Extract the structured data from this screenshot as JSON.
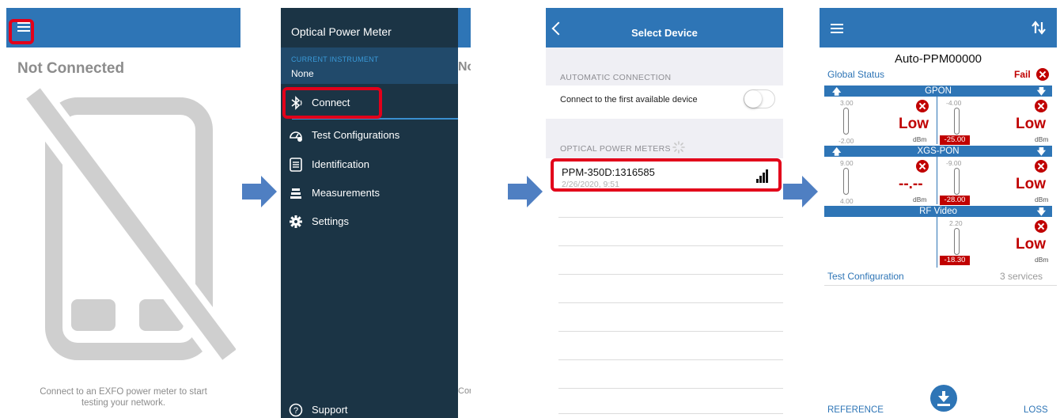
{
  "colors": {
    "accent": "#2e75b6",
    "drawer": "#1b3445",
    "alert_red": "#c00000",
    "highlight": "#e2001a"
  },
  "screen1": {
    "title": "Not Connected",
    "footer_line1": "Connect to an EXFO power meter to start",
    "footer_line2": "testing your network."
  },
  "screen2": {
    "drawer_title": "Optical Power Meter",
    "current_instrument_label": "CURRENT INSTRUMENT",
    "current_instrument_value": "None",
    "menu": [
      {
        "label": "Connect",
        "icon": "bluetooth-icon"
      },
      {
        "label": "Test Configurations",
        "icon": "gauge-icon"
      },
      {
        "label": "Identification",
        "icon": "id-list-icon"
      },
      {
        "label": "Measurements",
        "icon": "measurements-icon"
      },
      {
        "label": "Settings",
        "icon": "gear-icon"
      }
    ],
    "support_label": "Support",
    "peek_title": "Not C",
    "peek_footer": "Conn"
  },
  "screen3": {
    "title": "Select Device",
    "auto_section": "AUTOMATIC CONNECTION",
    "auto_row": "Connect to the first available device",
    "auto_toggle_on": false,
    "meters_section": "OPTICAL POWER METERS",
    "device": {
      "name": "PPM-350D:1316585",
      "date": "2/26/2020, 9:51"
    }
  },
  "screen4": {
    "title": "Auto-PPM00000",
    "global_status_label": "Global Status",
    "global_status_value": "Fail",
    "services": [
      {
        "name": "GPON",
        "up_max": "3.00",
        "up_min": "-2.00",
        "up_value": "Low",
        "down_max": "-4.00",
        "down_value": "Low",
        "down_reading": "-25.00",
        "unit": "dBm"
      },
      {
        "name": "XGS-PON",
        "up_max": "9.00",
        "up_min": "4.00",
        "up_value": "--.--",
        "down_max": "-9.00",
        "down_value": "Low",
        "down_reading": "-28.00",
        "unit": "dBm"
      },
      {
        "name": "RF Video",
        "down_max": "2.20",
        "down_value": "Low",
        "down_reading": "-18.30",
        "unit": "dBm"
      }
    ],
    "test_config_label": "Test Configuration",
    "test_config_value": "3 services",
    "reference_label": "REFERENCE",
    "loss_label": "LOSS"
  }
}
